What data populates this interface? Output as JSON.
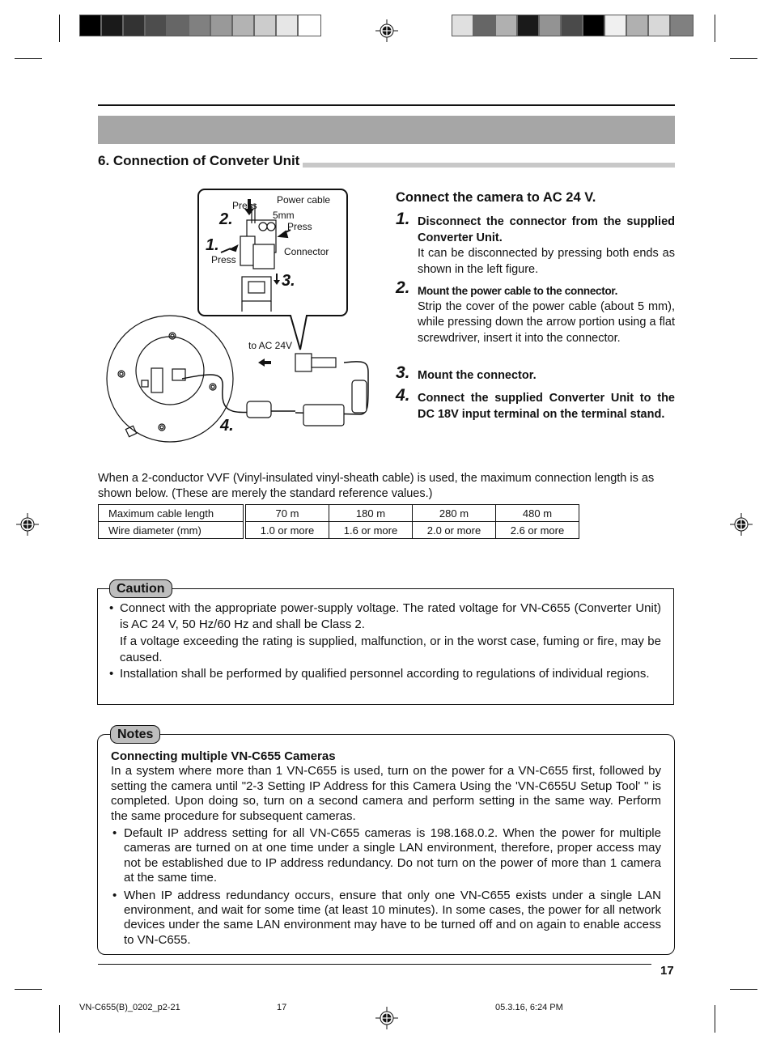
{
  "print_marks": {
    "left_color_bar": [
      "#000000",
      "#1a1a1a",
      "#333333",
      "#4d4d4d",
      "#666666",
      "#808080",
      "#999999",
      "#b3b3b3",
      "#cccccc",
      "#e6e6e6",
      "#ffffff"
    ],
    "right_color_bar": [
      "#e0e0e0",
      "#666666",
      "#b0b0b0",
      "#1a1a1a",
      "#939393",
      "#4a4a4a",
      "#000000",
      "#f0f0f0",
      "#b0b0b0",
      "#d8d8d8",
      "#808080"
    ]
  },
  "section": {
    "title": "6.  Connection of Conveter Unit"
  },
  "figure": {
    "labels": {
      "press_top": "Press",
      "power_cable": "Power cable",
      "five_mm": "5mm",
      "press_right": "Press",
      "press_left": "Press",
      "connector": "Connector",
      "to_ac": "to AC 24V"
    },
    "step_marks": [
      "1.",
      "2.",
      "3.",
      "4."
    ]
  },
  "instructions": {
    "title": "Connect the camera to AC 24 V.",
    "steps": [
      {
        "num": "1.",
        "head": "Disconnect the connector from the supplied Converter Unit.",
        "desc": "It can be disconnected by pressing both ends as shown in the left figure."
      },
      {
        "num": "2.",
        "head": "Mount the power cable to the connector.",
        "desc": "Strip the cover of the power cable (about 5 mm), while pressing down the arrow portion using a flat screwdriver, insert it into the connector."
      },
      {
        "num": "3.",
        "head": "Mount the connector.",
        "desc": ""
      },
      {
        "num": "4.",
        "head": "Connect the supplied Converter Unit to the DC 18V input terminal on the terminal stand.",
        "desc": ""
      }
    ]
  },
  "cable_info": {
    "intro": "When a 2-conductor VVF (Vinyl-insulated vinyl-sheath cable) is used, the maximum connection length is as shown below. (These are merely the standard reference values.)",
    "table": {
      "rows": [
        {
          "label": "Maximum cable length",
          "values": [
            "70 m",
            "180 m",
            "280 m",
            "480 m"
          ]
        },
        {
          "label": "Wire diameter (mm)",
          "values": [
            "1.0 or more",
            "1.6 or more",
            "2.0 or more",
            "2.6 or more"
          ]
        }
      ]
    }
  },
  "caution": {
    "tag": "Caution",
    "items": [
      "Connect with the appropriate power-supply voltage. The rated voltage for VN-C655 (Converter Unit) is AC 24 V, 50 Hz/60 Hz and shall be Class 2.",
      "If a voltage exceeding the rating is supplied, malfunction, or in the worst case, fuming or fire, may be caused.",
      "Installation shall be performed by qualified personnel according to regulations of individual regions."
    ]
  },
  "notes": {
    "tag": "Notes",
    "heading": "Connecting multiple VN-C655 Cameras",
    "paragraph": "In a system where more than 1 VN-C655 is used, turn on the power for a VN-C655 first, followed by setting the camera until \"2-3 Setting IP Address for this Camera Using the 'VN-C655U Setup Tool' \" is completed. Upon doing so, turn on a second camera and perform setting in the same way. Perform the same procedure for subsequent cameras.",
    "bullets": [
      "Default IP address setting for all VN-C655 cameras is 198.168.0.2. When the power for multiple cameras are turned on at one time under a single LAN environment, therefore, proper access may not be established due to IP address redundancy. Do not turn on the power of more than 1 camera at the same time.",
      "When IP address redundancy occurs, ensure that only one VN-C655 exists under a single LAN environment, and wait for some time (at least 10 minutes). In some cases, the power for all network devices under the same LAN environment may have to be turned off and on again to enable access to VN-C655."
    ]
  },
  "footer": {
    "page_number": "17",
    "slug_file": "VN-C655(B)_0202_p2-21",
    "slug_page": "17",
    "slug_date": "05.3.16, 6:24 PM"
  }
}
